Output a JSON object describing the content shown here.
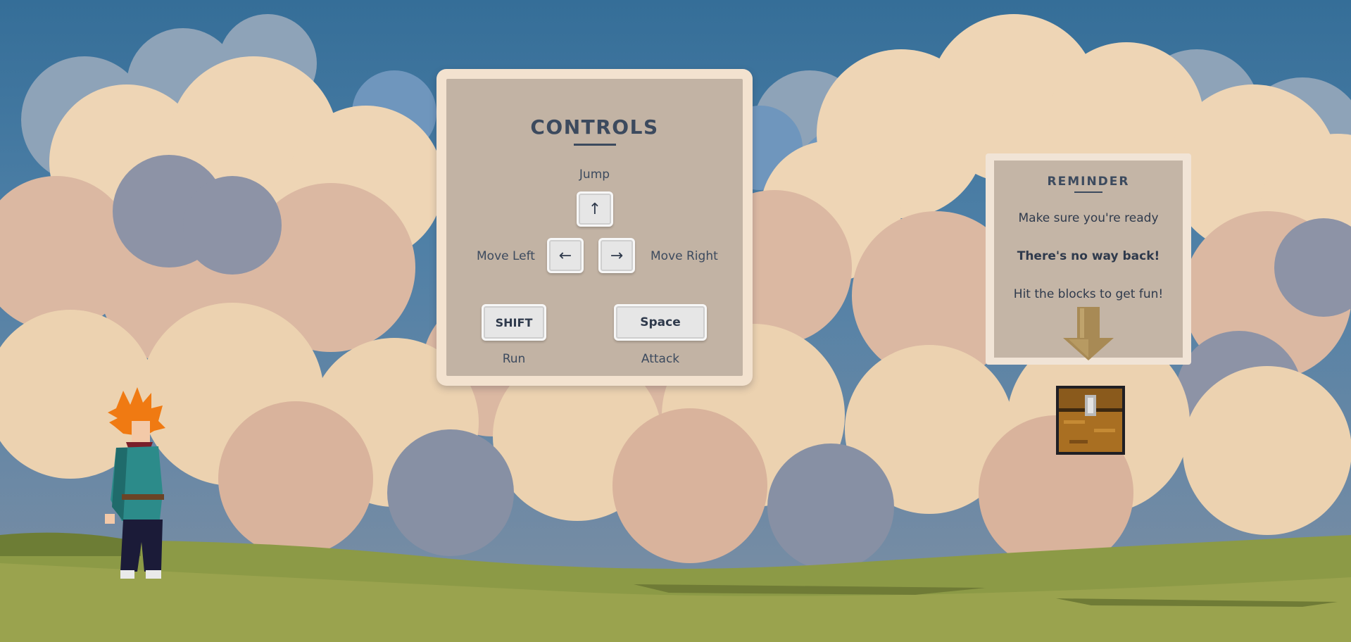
{
  "controls": {
    "title": "CONTROLS",
    "jump_label": "Jump",
    "jump_key": "↑",
    "left_label": "Move Left",
    "left_key": "←",
    "right_key": "→",
    "right_label": "Move Right",
    "run_key": "SHIFT",
    "run_label": "Run",
    "attack_key": "Space",
    "attack_label": "Attack"
  },
  "reminder": {
    "title": "REMINDER",
    "line1": "Make sure you're ready",
    "line2": "There's no way back!",
    "line3": "Hit the blocks to get fun!"
  },
  "colors": {
    "sky_top": "#356e98",
    "panel_frame": "#f3e2cf",
    "panel_fill": "#c2b3a4",
    "text": "#3c4a5e",
    "grass": "#8e9a47"
  },
  "icons": {
    "arrow": "down-arrow-icon",
    "chest": "treasure-chest-icon",
    "player": "player-character"
  }
}
